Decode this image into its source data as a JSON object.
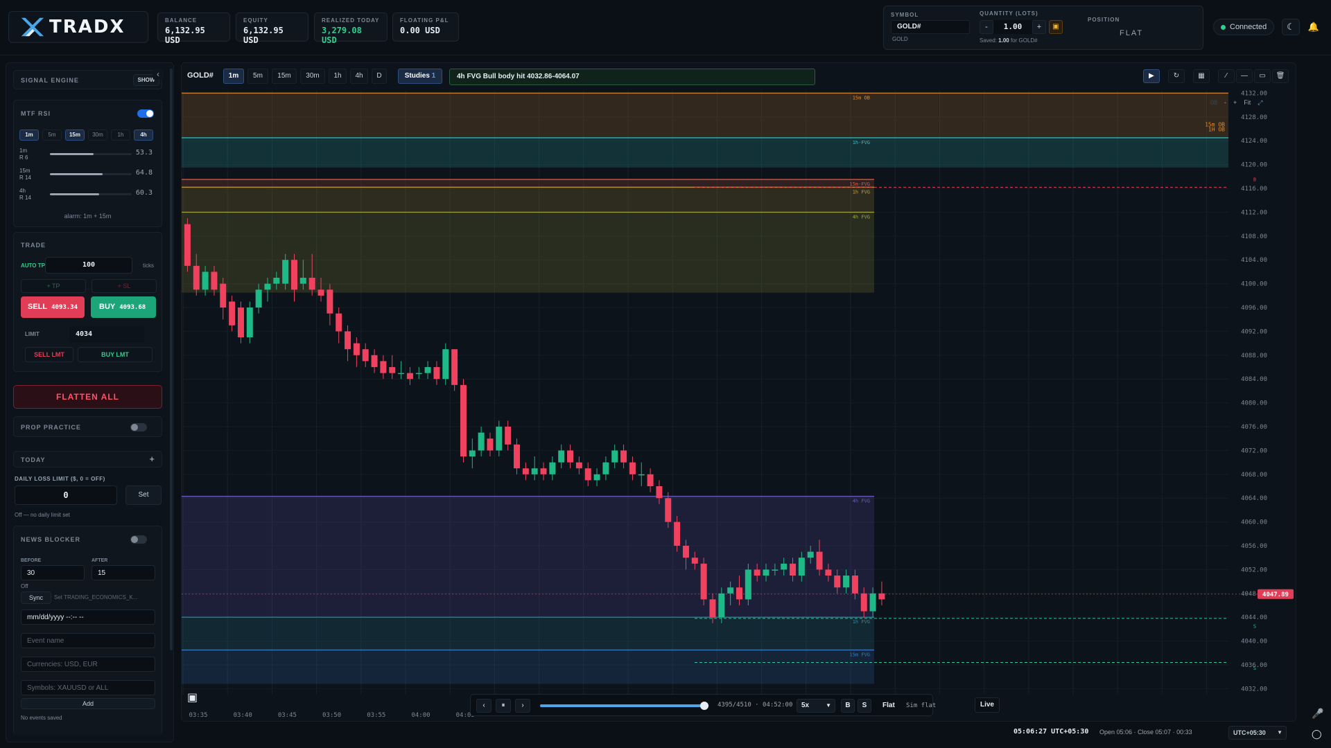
{
  "brand": {
    "name": "TRADX"
  },
  "topstats": [
    {
      "label": "BALANCE",
      "value": "6,132.95 USD",
      "color": "#e6edf3"
    },
    {
      "label": "EQUITY",
      "value": "6,132.95 USD",
      "color": "#e6edf3"
    },
    {
      "label": "REALIZED TODAY",
      "value": "3,279.08 USD",
      "color": "#2ecf8f"
    },
    {
      "label": "FLOATING P&L",
      "value": "0.00 USD",
      "color": "#e6edf3"
    }
  ],
  "symbol_panel": {
    "symbol_label": "SYMBOL",
    "symbol": "GOLD#",
    "sub": "GOLD",
    "qty_label": "QUANTITY (LOTS)",
    "qty": "1.00",
    "minus": "-",
    "plus": "+",
    "saved_pre": "Saved:",
    "saved_val": "1.00",
    "saved_post": "for GOLD#",
    "position_label": "POSITION",
    "position": "FLAT"
  },
  "connection": {
    "label": "Connected"
  },
  "signal_engine": {
    "title": "SIGNAL ENGINE",
    "show": "SHOW"
  },
  "mtf_rsi": {
    "title": "MTF RSI",
    "enabled": true,
    "timeframes": [
      "1m",
      "5m",
      "15m",
      "30m",
      "1h",
      "4h"
    ],
    "active": [
      "1m",
      "15m",
      "4h"
    ],
    "rows": [
      {
        "tf": "1m",
        "sub": "R 6",
        "value": "53.3",
        "level": 53.3
      },
      {
        "tf": "15m",
        "sub": "R 14",
        "value": "64.8",
        "level": 64.8
      },
      {
        "tf": "4h",
        "sub": "R 14",
        "value": "60.3",
        "level": 60.3
      }
    ],
    "alarm": "alarm: 1m + 15m"
  },
  "trade": {
    "title": "TRADE",
    "auto_tp_label": "AUTO TP",
    "auto_tp": "100",
    "ticks": "ticks",
    "tp": "+ TP",
    "sl": "+ SL",
    "sell_label": "SELL",
    "sell_price": "4093.34",
    "buy_label": "BUY",
    "buy_price": "4093.68",
    "limit_label": "LIMIT",
    "limit": "4034",
    "sell_lmt": "SELL LMT",
    "buy_lmt": "BUY LMT"
  },
  "flatten": "FLATTEN ALL",
  "prop": {
    "title": "PROP PRACTICE",
    "enabled": false
  },
  "today": {
    "title": "TODAY",
    "plus": "+"
  },
  "daily_loss": {
    "label": "DAILY LOSS LIMIT ($, 0 = OFF)",
    "value": "0",
    "set": "Set",
    "note": "Off — no daily limit set"
  },
  "news": {
    "title": "NEWS BLOCKER",
    "enabled": false,
    "before_label": "BEFORE",
    "before": "30",
    "after_label": "AFTER",
    "after": "15",
    "status": "Off",
    "sync": "Sync",
    "sync_hint": "Set TRADING_ECONOMICS_K...",
    "date_ph": "mm/dd/yyyy --:-- --",
    "event_ph": "Event name",
    "cur_ph": "Currencies: USD, EUR",
    "sym_ph": "Symbols: XAUUSD or ALL",
    "add": "Add",
    "empty": "No events saved"
  },
  "chart_header": {
    "symbol": "GOLD#",
    "timeframes": [
      "1m",
      "5m",
      "15m",
      "30m",
      "1h",
      "4h",
      "D"
    ],
    "active_tf": "1m",
    "studies": "Studies",
    "studies_count": "1",
    "signal": "4h FVG Bull body hit 4032.86-4064.07",
    "fit": "Fit",
    "minus": "-",
    "plus": "+"
  },
  "chart_data": {
    "type": "candlestick",
    "symbol": "GOLD#",
    "y_ticks": [
      4132,
      4128,
      4124,
      4120,
      4116,
      4112,
      4108,
      4104,
      4100,
      4096,
      4092,
      4088,
      4084,
      4080,
      4076,
      4072,
      4068,
      4064,
      4060,
      4056,
      4052,
      4048,
      4044,
      4040,
      4036,
      4032
    ],
    "y_tick_labels": [
      "4132.00",
      "4128.00",
      "4124.00",
      "4120.00",
      "4116.00",
      "4112.00",
      "4108.00",
      "4104.00",
      "4100.00",
      "4096.00",
      "4092.00",
      "4088.00",
      "4084.00",
      "4080.00",
      "4076.00",
      "4072.00",
      "4068.00",
      "4064.00",
      "4060.00",
      "4056.00",
      "4052.00",
      "4048.00",
      "4044.00",
      "4040.00",
      "4036.00",
      "4032.00"
    ],
    "ylim": [
      4031,
      4132.4
    ],
    "x_labels": [
      "03:35",
      "03:40",
      "03:45",
      "03:50",
      "03:55",
      "04:00",
      "04:05"
    ],
    "last_price": "4047.89",
    "last_price_value": 4047.89,
    "candles": [
      [
        4110,
        4103,
        4111,
        4102
      ],
      [
        4103,
        4099,
        4105,
        4098
      ],
      [
        4099,
        4102,
        4103,
        4098
      ],
      [
        4102,
        4099,
        4103,
        4098
      ],
      [
        4100,
        4096,
        4101,
        4094
      ],
      [
        4097,
        4093,
        4098,
        4092
      ],
      [
        4096,
        4091,
        4097,
        4090
      ],
      [
        4091,
        4096,
        4097,
        4090
      ],
      [
        4096,
        4099,
        4100,
        4095
      ],
      [
        4099,
        4100,
        4101,
        4097
      ],
      [
        4100,
        4101,
        4102,
        4099
      ],
      [
        4100,
        4104,
        4105,
        4099
      ],
      [
        4104,
        4099,
        4105,
        4097
      ],
      [
        4100,
        4101,
        4104,
        4099
      ],
      [
        4101,
        4099,
        4105,
        4098
      ],
      [
        4099,
        4098,
        4101,
        4097
      ],
      [
        4099,
        4095,
        4100,
        4093
      ],
      [
        4095,
        4092,
        4096,
        4090
      ],
      [
        4092,
        4089,
        4093,
        4087
      ],
      [
        4090,
        4088,
        4091,
        4086
      ],
      [
        4089,
        4087,
        4090,
        4086
      ],
      [
        4088,
        4086,
        4089,
        4085
      ],
      [
        4087,
        4085,
        4088,
        4084
      ],
      [
        4086,
        4085,
        4088,
        4084
      ],
      [
        4085,
        4085,
        4087,
        4084
      ],
      [
        4085,
        4084,
        4086,
        4083
      ],
      [
        4085,
        4085,
        4086,
        4084
      ],
      [
        4085,
        4086,
        4087,
        4084
      ],
      [
        4086,
        4084,
        4087,
        4083
      ],
      [
        4084,
        4089,
        4090,
        4083
      ],
      [
        4089,
        4083,
        4089,
        4082
      ],
      [
        4083,
        4071,
        4084,
        4070
      ],
      [
        4071,
        4072,
        4074,
        4069
      ],
      [
        4072,
        4075,
        4076,
        4071
      ],
      [
        4074,
        4072,
        4075,
        4071
      ],
      [
        4072,
        4076,
        4077,
        4071
      ],
      [
        4076,
        4073,
        4077,
        4072
      ],
      [
        4073,
        4069,
        4074,
        4068
      ],
      [
        4069,
        4068,
        4070,
        4067
      ],
      [
        4068,
        4069,
        4071,
        4067
      ],
      [
        4069,
        4068,
        4070,
        4067
      ],
      [
        4068,
        4070,
        4071,
        4067
      ],
      [
        4070,
        4072,
        4073,
        4069
      ],
      [
        4072,
        4070,
        4073,
        4069
      ],
      [
        4070,
        4069,
        4071,
        4068
      ],
      [
        4069,
        4067,
        4070,
        4066
      ],
      [
        4067,
        4068,
        4069,
        4066
      ],
      [
        4068,
        4070,
        4071,
        4067
      ],
      [
        4070,
        4072,
        4073,
        4069
      ],
      [
        4072,
        4070,
        4073,
        4069
      ],
      [
        4070,
        4068,
        4071,
        4067
      ],
      [
        4068,
        4068,
        4070,
        4066
      ],
      [
        4068,
        4066,
        4069,
        4065
      ],
      [
        4066,
        4064,
        4067,
        4063
      ],
      [
        4064,
        4060,
        4065,
        4059
      ],
      [
        4060,
        4056,
        4061,
        4055
      ],
      [
        4056,
        4054,
        4057,
        4052
      ],
      [
        4054,
        4053,
        4055,
        4052
      ],
      [
        4053,
        4047,
        4054,
        4046
      ],
      [
        4047,
        4044,
        4048,
        4043
      ],
      [
        4044,
        4048,
        4049,
        4043
      ],
      [
        4048,
        4049,
        4050,
        4046
      ],
      [
        4049,
        4047,
        4051,
        4046
      ],
      [
        4047,
        4052,
        4053,
        4046
      ],
      [
        4052,
        4051,
        4053,
        4050
      ],
      [
        4051,
        4052,
        4053,
        4050
      ],
      [
        4052,
        4052,
        4053,
        4051
      ],
      [
        4052,
        4053,
        4054,
        4051
      ],
      [
        4053,
        4051,
        4054,
        4050
      ],
      [
        4051,
        4054,
        4055,
        4050
      ],
      [
        4054,
        4055,
        4056,
        4053
      ],
      [
        4055,
        4052,
        4057,
        4051
      ],
      [
        4052,
        4051,
        4053,
        4050
      ],
      [
        4051,
        4049,
        4052,
        4048
      ],
      [
        4049,
        4051,
        4052,
        4048
      ],
      [
        4051,
        4048,
        4052,
        4047
      ],
      [
        4048,
        4045,
        4049,
        4044
      ],
      [
        4045,
        4048,
        4049,
        4044
      ],
      [
        4048,
        4047,
        4050,
        4046
      ]
    ],
    "zones": [
      {
        "label": "15m OB",
        "top": 4132,
        "bottom": 4124.5,
        "color": "#e08a2e",
        "kind": "ob"
      },
      {
        "label": "1h-FVG",
        "top": 4124.5,
        "bottom": 4119.5,
        "color": "#2ec4c4",
        "kind": "fvg"
      },
      {
        "label": "15m-FVG",
        "top": 4117.5,
        "bottom": 4116.2,
        "color": "#e0563a",
        "kind": "fvg"
      },
      {
        "label": "1h FVG",
        "top": 4116.2,
        "bottom": 4112,
        "color": "#c6a03a",
        "kind": "fvg"
      },
      {
        "label": "4h FVG",
        "top": 4112,
        "bottom": 4098.5,
        "color": "#a8a83a",
        "kind": "fvg"
      },
      {
        "label": "4h FVG",
        "top": 4064.3,
        "bottom": 4044,
        "color": "#6a5bc4",
        "kind": "fvg"
      },
      {
        "label": "1h FVG",
        "top": 4044,
        "bottom": 4038.5,
        "color": "#2a8aa8",
        "kind": "fvg"
      },
      {
        "label": "15m FVG",
        "top": 4038.5,
        "bottom": 4032.8,
        "color": "#3a78c8",
        "kind": "fvg"
      }
    ],
    "zone_tags": [
      {
        "text": "15m OB",
        "price": 4126.4
      },
      {
        "text": "1H OB",
        "price": 4125.6
      }
    ],
    "levels": [
      {
        "price": 4116.2,
        "color": "#e03a5a"
      },
      {
        "price": 4043.8,
        "color": "#2ec4a0"
      },
      {
        "price": 4036.4,
        "color": "#2ec4a0"
      }
    ],
    "level_marks": [
      {
        "text": "B",
        "price": 4117.2,
        "color": "#e03a5a"
      },
      {
        "text": "S",
        "price": 4042.2,
        "color": "#2ec4a0"
      },
      {
        "text": "S",
        "price": 4035.2,
        "color": "#2ec4a0"
      }
    ]
  },
  "playbar": {
    "prev": "‹",
    "pause": "⏸",
    "next": "›",
    "position": "4395/4510 · 04:52:00",
    "progress": 0.97,
    "speed": "5x",
    "b": "B",
    "s": "S",
    "flat": "Flat",
    "sim": "Sim flat",
    "live": "Live"
  },
  "status": {
    "clock": "05:06:27 UTC+05:30",
    "bar": "Open 05:06 · Close 05:07 · 00:33",
    "tz": "UTC+05:30"
  }
}
